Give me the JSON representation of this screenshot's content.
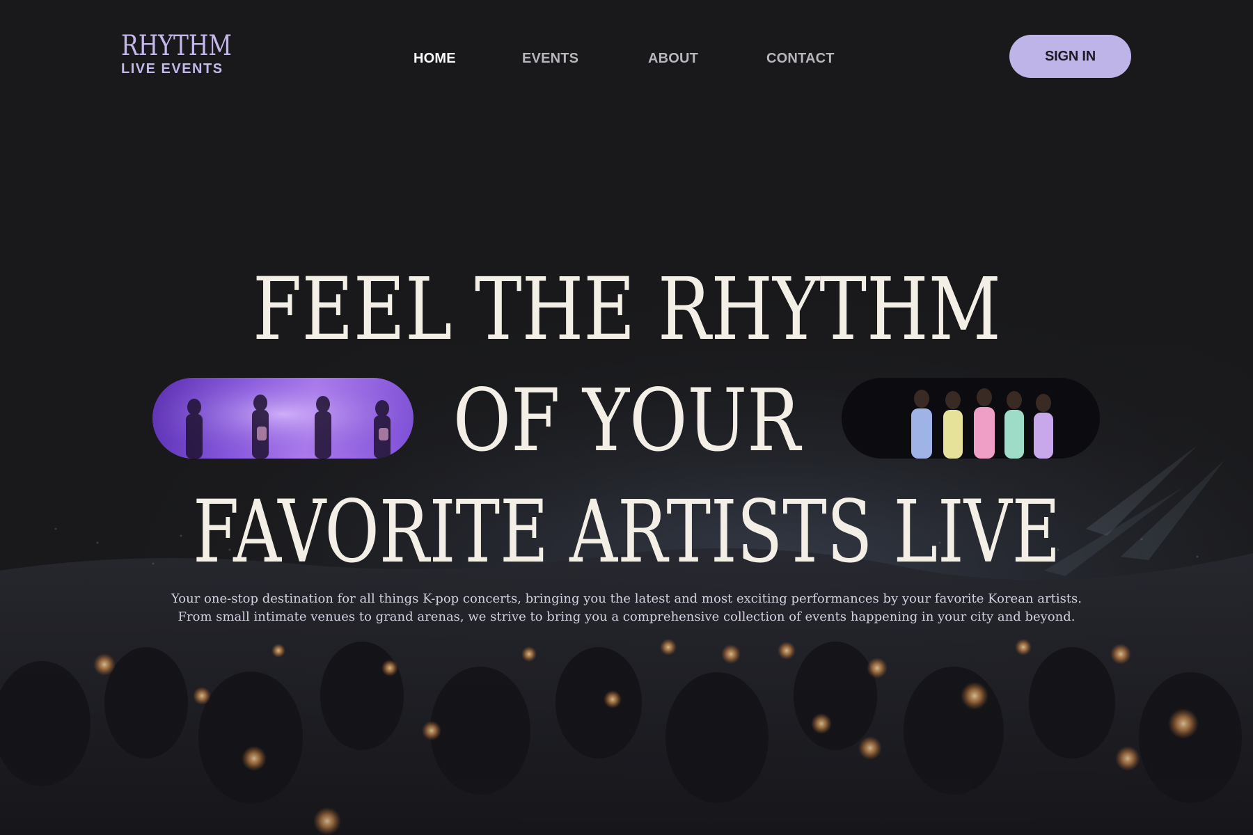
{
  "brand": {
    "name": "RHYTHM",
    "tagline": "LIVE EVENTS"
  },
  "nav": {
    "items": [
      {
        "label": "HOME",
        "active": true
      },
      {
        "label": "EVENTS",
        "active": false
      },
      {
        "label": "ABOUT",
        "active": false
      },
      {
        "label": "CONTACT",
        "active": false
      }
    ],
    "signin_label": "SIGN IN"
  },
  "hero": {
    "line1": "FEEL THE RHYTHM",
    "line2": "OF YOUR",
    "line3": "FAVORITE ARTISTS LIVE",
    "subtitle_line1": "Your one-stop destination for all things K-pop concerts, bringing you the latest and most exciting performances by your favorite Korean artists.",
    "subtitle_line2": "From small intimate venues to grand arenas, we strive to bring you a comprehensive collection of events happening in your city and beyond."
  },
  "colors": {
    "background": "#19191b",
    "accent": "#bfb4e8",
    "logo": "#c4b7ec",
    "headline": "#f3efe6",
    "nav_inactive": "#b8b6bd",
    "nav_active": "#ffffff"
  },
  "images": {
    "left_pill": "girl-group-performing-on-purple-stage-photo",
    "right_pill": "girl-group-in-pastel-dresses-posing-photo",
    "background": "concert-crowd-with-lightsticks-photo"
  }
}
